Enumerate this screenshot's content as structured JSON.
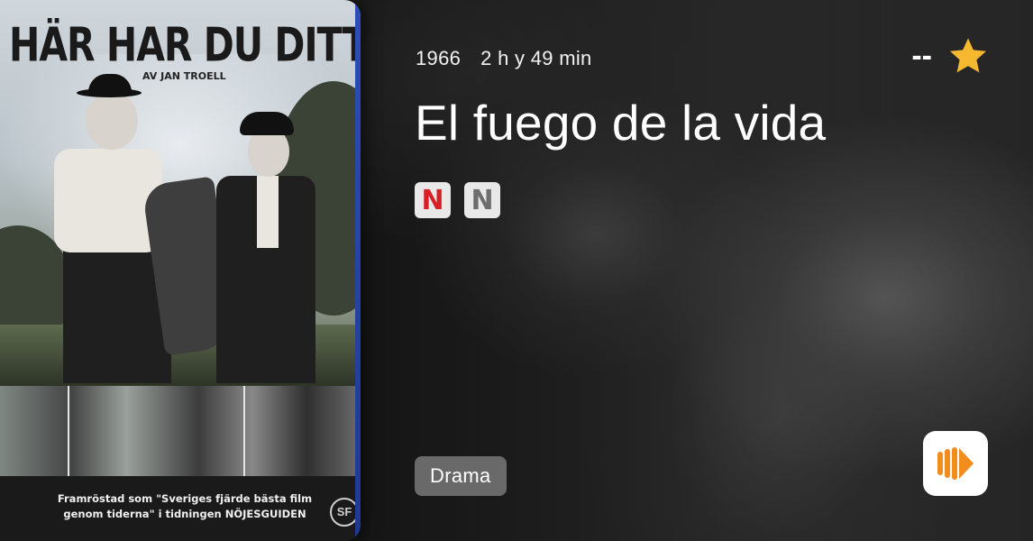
{
  "poster": {
    "title": "HÄR HAR DU DITT LIV",
    "byline": "AV JAN TROELL",
    "caption_line1": "Framröstad som \"Sveriges fjärde bästa film",
    "caption_line2": "genom tiderna\" i tidningen NÖJESGUIDEN",
    "logo_text": "SF"
  },
  "movie": {
    "year": "1966",
    "duration": "2 h y 49 min",
    "rating": "--",
    "title": "El fuego de la vida",
    "genre": "Drama"
  },
  "providers": [
    {
      "name": "netflix-icon",
      "letter": "N",
      "color": "#d81f26"
    },
    {
      "name": "netflix-gray-icon",
      "letter": "N",
      "color": "#6d6d6d"
    }
  ],
  "colors": {
    "star": "#f5b82e",
    "app_accent": "#f28c1c"
  },
  "icons": {
    "rating": "star-icon",
    "app": "play-app-icon"
  }
}
